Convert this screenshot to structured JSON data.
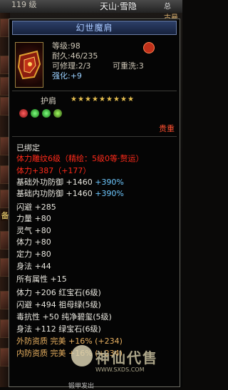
{
  "top": {
    "level": "119 级",
    "location": "天山·雪隐",
    "corner_top": "总",
    "corner_bottom": "古曼"
  },
  "left_strip": {
    "label": "备"
  },
  "item": {
    "name": "幻世魔肩",
    "level": "等级:98",
    "durability": "耐久:46/235",
    "repairable": "可修理:2/3",
    "rewashable": "可重洗:3",
    "enhance_label": "强化:",
    "enhance_value": "+9",
    "slot": "护肩",
    "stars": [
      "★",
      "★",
      "★",
      "★",
      "★",
      "★",
      "★",
      "★",
      "★"
    ],
    "grade": "贵重",
    "bound": "已绑定"
  },
  "attributes": [
    {
      "text": "体力雕纹6级（精绘：5级0等·赘运）",
      "color": "red"
    },
    {
      "text": "体力+387（+177）",
      "color": "red"
    },
    {
      "parts": [
        {
          "t": "基础外功防御 +1460 ",
          "c": "white"
        },
        {
          "t": "+390%",
          "c": "blue"
        }
      ]
    },
    {
      "parts": [
        {
          "t": "基础内功防御 +1460 ",
          "c": "white"
        },
        {
          "t": "+390%",
          "c": "blue"
        }
      ]
    },
    {
      "text": "闪避 +285",
      "color": "white"
    },
    {
      "text": "力量 +80",
      "color": "white"
    },
    {
      "text": "灵气 +80",
      "color": "white"
    },
    {
      "text": "体力 +80",
      "color": "white"
    },
    {
      "text": "定力 +80",
      "color": "white"
    },
    {
      "text": "身法 +44",
      "color": "white"
    },
    {
      "text": "所有属性 +15",
      "color": "white"
    },
    {
      "text": "体力 +206 红宝石(6级)",
      "color": "white"
    },
    {
      "text": "闪避 +494 祖母绿(5级)",
      "color": "white"
    },
    {
      "text": "毒抗性 +50 纯净碧玺(5级)",
      "color": "white"
    },
    {
      "text": "身法 +112 绿宝石(6级)",
      "color": "white"
    },
    {
      "text": "外防资质  完美 +16% (+234)",
      "color": "orange"
    },
    {
      "text": "内防资质  完美 +16% (+234)",
      "color": "orange"
    }
  ],
  "watermark": {
    "brand": "神仙代售",
    "url": "WWW.SXDS.COM"
  },
  "bottom_text": "锻甲发出"
}
